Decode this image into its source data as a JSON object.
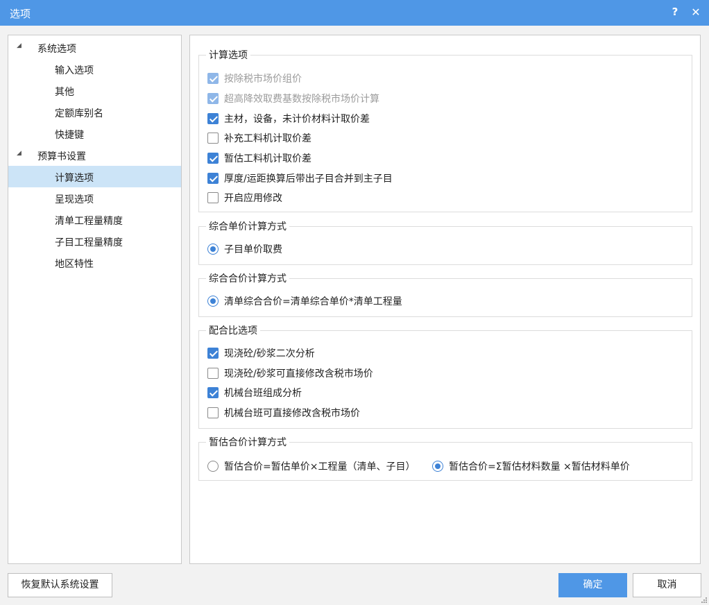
{
  "window": {
    "title": "选项",
    "help_label": "?",
    "close_label": "✕"
  },
  "tree": {
    "items": [
      {
        "label": "系统选项",
        "level": 0,
        "expanded": true
      },
      {
        "label": "输入选项",
        "level": 1
      },
      {
        "label": "其他",
        "level": 1
      },
      {
        "label": "定额库别名",
        "level": 1
      },
      {
        "label": "快捷键",
        "level": 1
      },
      {
        "label": "预算书设置",
        "level": 0,
        "expanded": true
      },
      {
        "label": "计算选项",
        "level": 1,
        "selected": true
      },
      {
        "label": "呈现选项",
        "level": 1
      },
      {
        "label": "清单工程量精度",
        "level": 1
      },
      {
        "label": "子目工程量精度",
        "level": 1
      },
      {
        "label": "地区特性",
        "level": 1
      }
    ],
    "expand_glyph": "◢"
  },
  "calc_options": {
    "title": "计算选项",
    "items": [
      {
        "label": "按除税市场价组价",
        "checked": true,
        "disabled": true
      },
      {
        "label": "超高降效取费基数按除税市场价计算",
        "checked": true,
        "disabled": true
      },
      {
        "label": "主材，设备，未计价材料计取价差",
        "checked": true,
        "disabled": false
      },
      {
        "label": "补充工料机计取价差",
        "checked": false,
        "disabled": false
      },
      {
        "label": "暂估工料机计取价差",
        "checked": true,
        "disabled": false
      },
      {
        "label": "厚度/运距换算后带出子目合并到主子目",
        "checked": true,
        "disabled": false
      },
      {
        "label": "开启应用修改",
        "checked": false,
        "disabled": false
      }
    ]
  },
  "unit_price_method": {
    "title": "综合单价计算方式",
    "options": [
      {
        "label": "子目单价取费",
        "selected": true
      }
    ]
  },
  "total_price_method": {
    "title": "综合合价计算方式",
    "options": [
      {
        "label": "清单综合合价=清单综合单价*清单工程量",
        "selected": true
      }
    ]
  },
  "mix_ratio": {
    "title": "配合比选项",
    "items": [
      {
        "label": "现浇砼/砂浆二次分析",
        "checked": true
      },
      {
        "label": "现浇砼/砂浆可直接修改含税市场价",
        "checked": false
      },
      {
        "label": "机械台班组成分析",
        "checked": true
      },
      {
        "label": "机械台班可直接修改含税市场价",
        "checked": false
      }
    ]
  },
  "provisional_method": {
    "title": "暂估合价计算方式",
    "options": [
      {
        "label": "暂估合价=暂估单价×工程量（清单、子目）",
        "selected": false
      },
      {
        "label": "暂估合价=Σ暂估材料数量 ×暂估材料单价",
        "selected": true
      }
    ]
  },
  "footer": {
    "restore_label": "恢复默认系统设置",
    "ok_label": "确定",
    "cancel_label": "取消"
  },
  "colors": {
    "accent": "#4f97e6",
    "check": "#3d82d6",
    "selection": "#cce4f7"
  }
}
